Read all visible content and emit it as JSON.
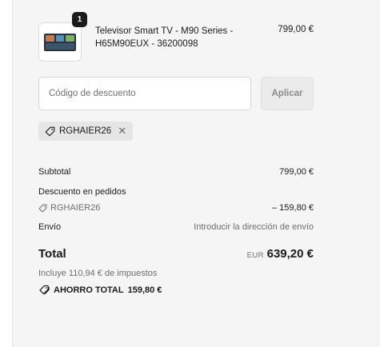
{
  "cart": {
    "item": {
      "quantity": "1",
      "name": "Televisor Smart TV - M90 Series - H65M90EUX - 36200098",
      "price": "799,00 €"
    }
  },
  "discount": {
    "placeholder": "Código de descuento",
    "apply_label": "Aplicar",
    "applied_code": "RGHAIER26",
    "remove_symbol": "✕"
  },
  "summary": {
    "subtotal_label": "Subtotal",
    "subtotal_value": "799,00 €",
    "order_discount_label": "Descuento en pedidos",
    "order_discount_code": "RGHAIER26",
    "order_discount_value": "– 159,80 €",
    "shipping_label": "Envío",
    "shipping_value": "Introducir la dirección de envío",
    "total_label": "Total",
    "total_currency": "EUR",
    "total_value": "639,20 €",
    "taxes_note": "Incluye 110,94 € de impuestos",
    "savings_label": "AHORRO TOTAL",
    "savings_value": "159,80 €"
  },
  "icons": {
    "tag": "tag-icon",
    "tags": "tags-icon",
    "close": "close-icon"
  }
}
